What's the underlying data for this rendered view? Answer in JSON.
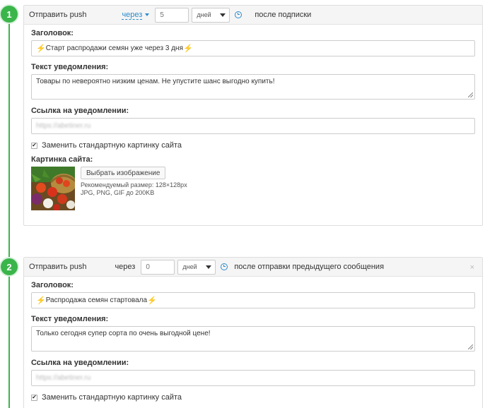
{
  "steps": [
    {
      "number": "1",
      "header": {
        "send_label": "Отправить push",
        "delay_mode": "через",
        "delay_value_placeholder": "5",
        "unit": "дней",
        "after_label": "после подписки"
      },
      "title_label": "Заголовок:",
      "title_value": "Старт распродажи семян уже через 3 дня",
      "text_label": "Текст уведомления:",
      "text_value": "Товары по невероятно низким ценам. Не упустите шанс выгодно купить!",
      "link_label": "Ссылка на уведомлении:",
      "link_value": "https://abetiner.ru",
      "replace_image_label": "Заменить стандартную картинку сайта",
      "replace_image_checked": true,
      "image_label": "Картинка сайта:",
      "choose_image_button": "Выбрать изображение",
      "recommended_size": "Рекомендуемый размер: 128×128px",
      "formats": "JPG, PNG, GIF до 200KB"
    },
    {
      "number": "2",
      "header": {
        "send_label": "Отправить push",
        "delay_mode": "через",
        "delay_value_placeholder": "0",
        "unit": "дней",
        "after_label": "после отправки предыдущего сообщения",
        "close_icon": "×"
      },
      "title_label": "Заголовок:",
      "title_value": "Распродажа семян стартовала",
      "text_label": "Текст уведомления:",
      "text_value": "Только сегодня супер сорта по очень выгодной цене!",
      "link_label": "Ссылка на уведомлении:",
      "link_value": "https://abetiner.ru",
      "replace_image_label": "Заменить стандартную картинку сайта",
      "replace_image_checked": true
    }
  ],
  "icons": {
    "bolt": "lightning-icon",
    "clock": "clock-icon",
    "check": "✔"
  },
  "colors": {
    "accent_green": "#3ab54a",
    "link_blue": "#2a8ccc",
    "bolt": "#e7a414"
  }
}
